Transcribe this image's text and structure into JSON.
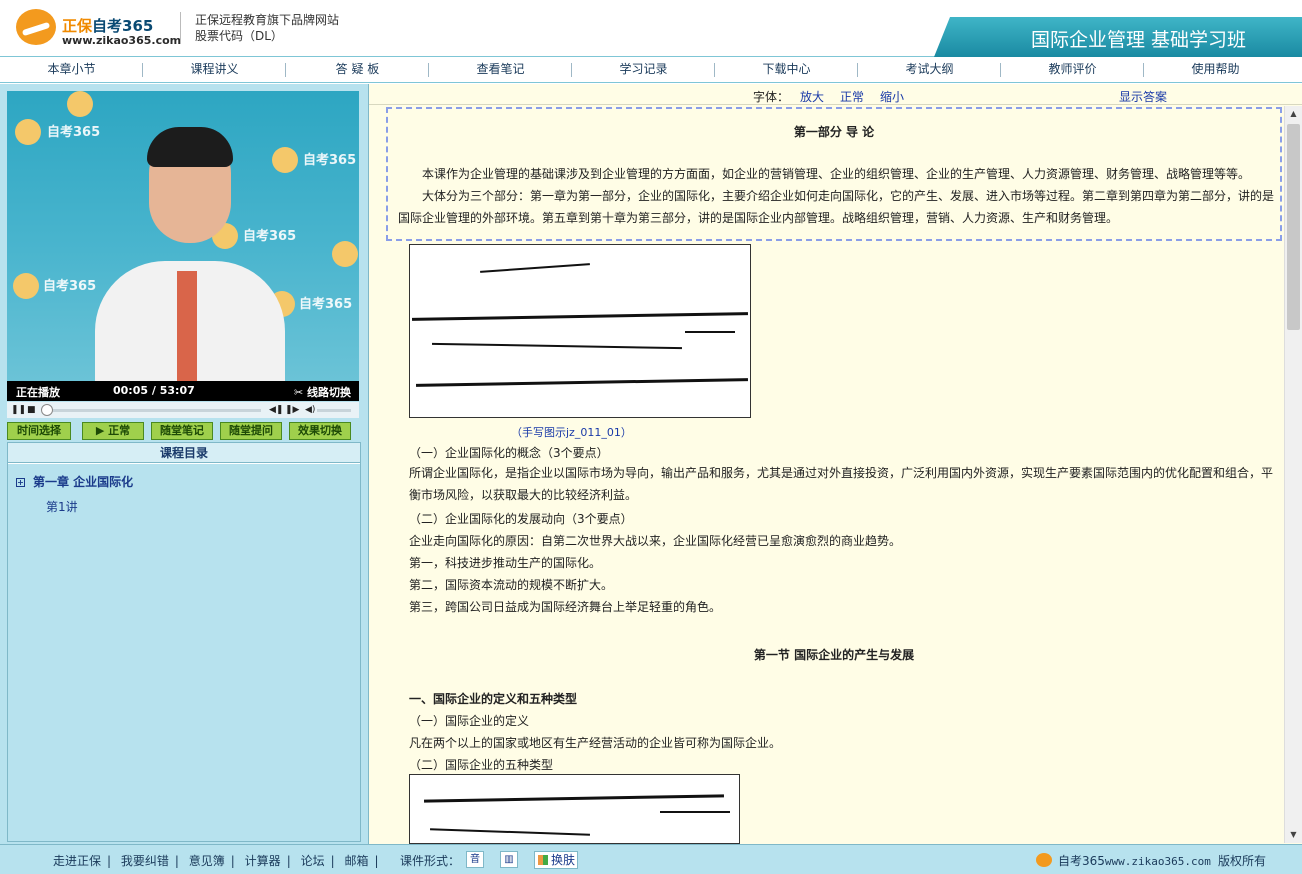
{
  "header": {
    "brand_orange": "正保",
    "brand_rest": "自考365",
    "brand_url": "www.zikao365.com",
    "desc_line1": "正保远程教育旗下品牌网站",
    "desc_line2": "股票代码（DL）",
    "course_title": "国际企业管理 基础学习班"
  },
  "nav": {
    "items": [
      "本章小节",
      "课程讲义",
      "答 疑 板",
      "查看笔记",
      "学习记录",
      "下载中心",
      "考试大纲",
      "教师评价",
      "使用帮助"
    ]
  },
  "player": {
    "watermark": "自考365",
    "watermark_url": "www.zikao365.com",
    "status": "正在播放",
    "time_current": "00:05",
    "time_separator": "/",
    "time_total": "53:07",
    "switch_label": "线路切换",
    "progress": 0.0016,
    "buttons": [
      "时间选择",
      "正常",
      "随堂笔记",
      "随堂提问",
      "效果切换"
    ]
  },
  "toc": {
    "title": "课程目录",
    "chapter": "第一章   企业国际化",
    "lecture": "第1讲"
  },
  "fontbar": {
    "label": "字体：",
    "enlarge": "放大",
    "normal": "正常",
    "shrink": "缩小",
    "show_answer": "显示答案"
  },
  "intro": {
    "title": "第一部分   导   论",
    "para1": "本课作为企业管理的基础课涉及到企业管理的方方面面，如企业的营销管理、企业的组织管理、企业的生产管理、人力资源管理、财务管理、战略管理等等。",
    "para2": "大体分为三个部分：第一章为第一部分，企业的国际化，主要介绍企业如何走向国际化，它的产生、发展、进入市场等过程。第二章到第四章为第二部分，讲的是国际企业管理的外部环境。第五章到第十章为第三部分，讲的是国际企业内部管理。战略组织管理，营销、人力资源、生产和财务管理。"
  },
  "content": {
    "hw1_caption": "（手写图示jz_011_01）",
    "h_concept": "（一）企业国际化的概念（3个要点）",
    "p_concept": "所谓企业国际化，是指企业以国际市场为导向，输出产品和服务，尤其是通过对外直接投资，广泛利用国内外资源，实现生产要素国际范围内的优化配置和组合，平衡市场风险，以获取最大的比较经济利益。",
    "h_trend": "（二）企业国际化的发展动向（3个要点）",
    "p_trend": "企业走向国际化的原因：自第二次世界大战以来，企业国际化经营已呈愈演愈烈的商业趋势。",
    "p_first": "第一，科技进步推动生产的国际化。",
    "p_second": "第二，国际资本流动的规模不断扩大。",
    "p_third": "第三，跨国公司日益成为国际经济舞台上举足轻重的角色。",
    "section1": "第一节   国际企业的产生与发展",
    "h_one": "一、国际企业的定义和五种类型",
    "h_def": "（一）国际企业的定义",
    "p_def": "凡在两个以上的国家或地区有生产经营活动的企业皆可称为国际企业。",
    "h_types": "（二）国际企业的五种类型"
  },
  "footer": {
    "links": [
      "走进正保",
      "我要纠错",
      "意见簿",
      "计算器",
      "论坛",
      "邮箱"
    ],
    "format_label": "课件形式：",
    "skin_label": "换肤",
    "brand": "自考365",
    "brand_url": "www.zikao365.com",
    "copyright": "版权所有"
  },
  "colors": {
    "accent": "#1d8ea6",
    "panel_bg": "#b7e2ee",
    "content_bg": "#fffde6",
    "link": "#1a3aa8",
    "button_green": "#9fd04c"
  }
}
